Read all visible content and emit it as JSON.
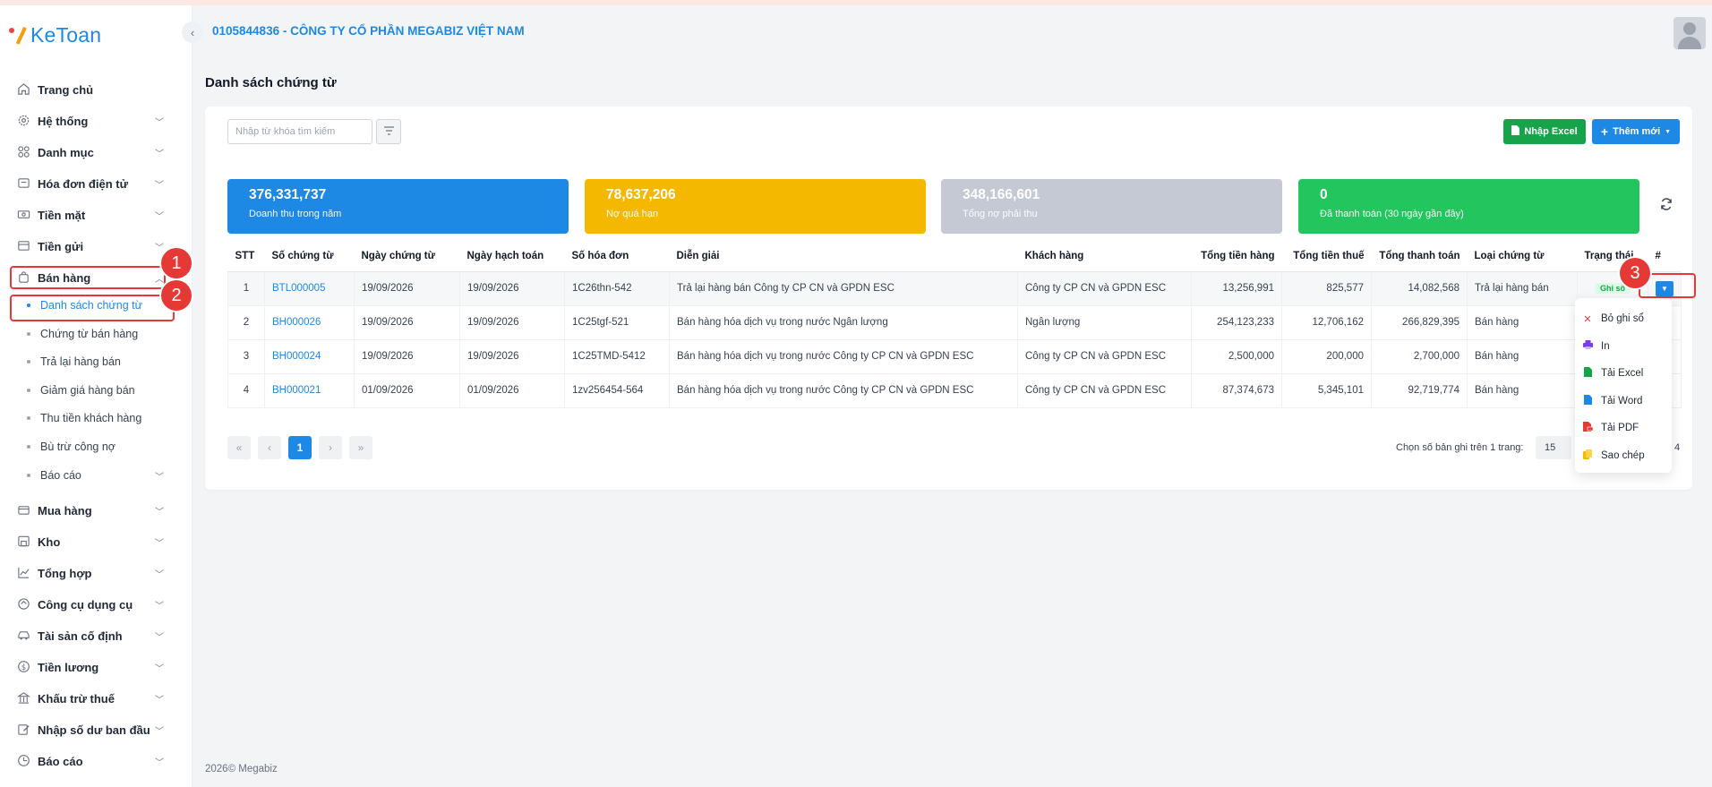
{
  "app": {
    "logo_text": "KeToan",
    "company": "0105844836 - CÔNG TY CỔ PHẦN MEGABIZ VIỆT NAM",
    "footer": "2026© Megabiz"
  },
  "sidebar": {
    "items": [
      {
        "label": "Trang chủ",
        "icon": "home-icon"
      },
      {
        "label": "Hệ thống",
        "icon": "gear-icon"
      },
      {
        "label": "Danh mục",
        "icon": "grid-icon"
      },
      {
        "label": "Hóa đơn điện tử",
        "icon": "receipt-icon"
      },
      {
        "label": "Tiền mặt",
        "icon": "cash-icon"
      },
      {
        "label": "Tiền gửi",
        "icon": "bank-icon"
      },
      {
        "label": "Bán hàng",
        "icon": "bag-icon"
      },
      {
        "label": "Mua hàng",
        "icon": "cart-icon"
      },
      {
        "label": "Kho",
        "icon": "warehouse-icon"
      },
      {
        "label": "Tổng hợp",
        "icon": "chart-icon"
      },
      {
        "label": "Công cụ dụng cụ",
        "icon": "tools-icon"
      },
      {
        "label": "Tài sản cố định",
        "icon": "car-icon"
      },
      {
        "label": "Tiền lương",
        "icon": "dollar-icon"
      },
      {
        "label": "Khấu trừ thuế",
        "icon": "building-icon"
      },
      {
        "label": "Nhập số dư ban đầu",
        "icon": "edit-icon"
      },
      {
        "label": "Báo cáo",
        "icon": "report-icon"
      }
    ],
    "sub_items": [
      {
        "label": "Danh sách chứng từ"
      },
      {
        "label": "Chứng từ bán hàng"
      },
      {
        "label": "Trả lại hàng bán"
      },
      {
        "label": "Giảm giá hàng bán"
      },
      {
        "label": "Thu tiền khách hàng"
      },
      {
        "label": "Bù trừ công nợ"
      },
      {
        "label": "Báo cáo"
      }
    ]
  },
  "annotations": [
    "1",
    "2",
    "3"
  ],
  "page": {
    "title": "Danh sách chứng từ",
    "search_placeholder": "Nhập từ khóa tìm kiếm",
    "btn_import": "Nhập Excel",
    "btn_add": "Thêm mới"
  },
  "stats": [
    {
      "value": "376,331,737",
      "label": "Doanh thu trong năm",
      "color": "#1e88e5"
    },
    {
      "value": "78,637,206",
      "label": "Nợ quá hạn",
      "color": "#f5b800"
    },
    {
      "value": "348,166,601",
      "label": "Tổng nợ phải thu",
      "color": "#c5c9d3"
    },
    {
      "value": "0",
      "label": "Đã thanh toán (30 ngày gần đây)",
      "color": "#22c55e"
    }
  ],
  "table": {
    "headers": [
      "STT",
      "Số chứng từ",
      "Ngày chứng từ",
      "Ngày hạch toán",
      "Số hóa đơn",
      "Diễn giải",
      "Khách hàng",
      "Tổng tiền hàng",
      "Tổng tiền thuế",
      "Tổng thanh toán",
      "Loại chứng từ",
      "Trạng thái",
      "#"
    ],
    "rows": [
      [
        "1",
        "BTL000005",
        "19/09/2026",
        "19/09/2026",
        "1C26thn-542",
        "Trả lại hàng bán Công ty CP CN và GPDN ESC",
        "Công ty CP CN và GPDN ESC",
        "13,256,991",
        "825,577",
        "14,082,568",
        "Trả lại hàng bán",
        "Ghi sổ"
      ],
      [
        "2",
        "BH000026",
        "19/09/2026",
        "19/09/2026",
        "1C25tgf-521",
        "Bán hàng hóa dịch vụ trong nước Ngân lượng",
        "Ngân lượng",
        "254,123,233",
        "12,706,162",
        "266,829,395",
        "Bán hàng",
        ""
      ],
      [
        "3",
        "BH000024",
        "19/09/2026",
        "19/09/2026",
        "1C25TMD-5412",
        "Bán hàng hóa dịch vụ trong nước Công ty CP CN và GPDN ESC",
        "Công ty CP CN và GPDN ESC",
        "2,500,000",
        "200,000",
        "2,700,000",
        "Bán hàng",
        ""
      ],
      [
        "4",
        "BH000021",
        "01/09/2026",
        "01/09/2026",
        "1zv256454-564",
        "Bán hàng hóa dịch vụ trong nước Công ty CP CN và GPDN ESC",
        "Công ty CP CN và GPDN ESC",
        "87,374,673",
        "5,345,101",
        "92,719,774",
        "Bán hàng",
        ""
      ]
    ]
  },
  "pagination": {
    "current": "1",
    "per_page_label": "Chọn số bản ghi trên 1 trang:",
    "per_page": "15",
    "total_tail": "4"
  },
  "dropdown": {
    "items": [
      {
        "label": "Bỏ ghi sổ",
        "icon": "close-icon",
        "color": "#e53935"
      },
      {
        "label": "In",
        "icon": "printer-icon",
        "color": "#7c3aed"
      },
      {
        "label": "Tải Excel",
        "icon": "excel-file-icon",
        "color": "#16a34a"
      },
      {
        "label": "Tải Word",
        "icon": "word-file-icon",
        "color": "#1e88e5"
      },
      {
        "label": "Tải PDF",
        "icon": "pdf-file-icon",
        "color": "#e53935"
      },
      {
        "label": "Sao chép",
        "icon": "copy-icon",
        "color": "#f5b800"
      }
    ]
  }
}
